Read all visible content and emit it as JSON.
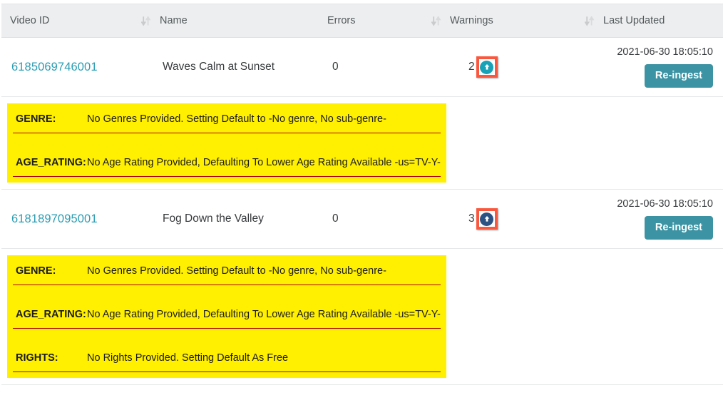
{
  "table": {
    "columns": [
      {
        "label": "Video ID",
        "sortable": true,
        "name": "video-id"
      },
      {
        "label": "Name",
        "sortable": true,
        "name": "name"
      },
      {
        "label": "Errors",
        "sortable": false,
        "name": "errors"
      },
      {
        "label": "Warnings",
        "sortable": true,
        "name": "warnings"
      },
      {
        "label": "Last Updated",
        "sortable": true,
        "name": "last-updated"
      }
    ],
    "rows": [
      {
        "video_id": "6185069746001",
        "name": "Waves Calm at Sunset",
        "errors": "0",
        "warnings": "2",
        "last_updated": "2021-06-30 18:05:10",
        "reingest_label": "Re-ingest",
        "warning_icon": "upload-circle-icon",
        "warning_icon_color": "#17a2b8",
        "highlight_color": "#f9583f",
        "details": [
          {
            "key": "GENRE:",
            "message": "No Genres Provided. Setting Default to -No genre, No sub-genre-"
          },
          {
            "key": "AGE_RATING:",
            "message": "No Age Rating Provided, Defaulting To Lower Age Rating Available -us=TV-Y-"
          }
        ]
      },
      {
        "video_id": "6181897095001",
        "name": "Fog Down the Valley",
        "errors": "0",
        "warnings": "3",
        "last_updated": "2021-06-30 18:05:10",
        "reingest_label": "Re-ingest",
        "warning_icon": "upload-circle-icon",
        "warning_icon_color": "#2b5282",
        "highlight_color": "#f9583f",
        "details": [
          {
            "key": "GENRE:",
            "message": "No Genres Provided. Setting Default to -No genre, No sub-genre-"
          },
          {
            "key": "AGE_RATING:",
            "message": "No Age Rating Provided, Defaulting To Lower Age Rating Available -us=TV-Y-"
          },
          {
            "key": "RIGHTS:",
            "message": "No Rights Provided. Setting Default As Free"
          }
        ]
      }
    ]
  },
  "theme": {
    "link_color": "#2a9db3",
    "button_color": "#3c93a3",
    "warning_panel_color": "#ffef00",
    "warning_rule_color": "#b00000",
    "header_bg": "#eceeef"
  }
}
